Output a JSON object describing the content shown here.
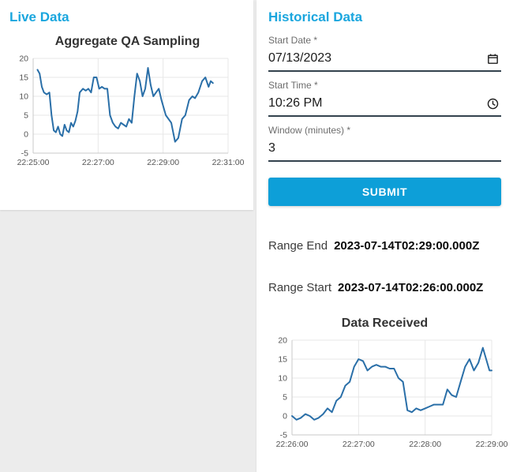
{
  "colors": {
    "accent": "#1aa6de",
    "button": "#0d9fd8",
    "underline": "#33424d",
    "chart_line": "#2a6fa8",
    "grid": "#e7e7e7"
  },
  "live_panel": {
    "title": "Live Data"
  },
  "historical_panel": {
    "title": "Historical Data",
    "fields": [
      {
        "label": "Start Date *",
        "value": "07/13/2023",
        "icon": "calendar-icon"
      },
      {
        "label": "Start Time *",
        "value": "10:26 PM",
        "icon": "clock-icon"
      },
      {
        "label": "Window (minutes) *",
        "value": "3",
        "icon": "none"
      }
    ],
    "submit_label": "SUBMIT",
    "range_end_label": "Range End",
    "range_end_value": "2023-07-14T02:29:00.000Z",
    "range_start_label": "Range Start",
    "range_start_value": "2023-07-14T02:26:00.000Z"
  },
  "chart_data": [
    {
      "type": "line",
      "title": "Aggregate QA Sampling",
      "xlabel": "",
      "ylabel": "",
      "legend": "none",
      "grid": true,
      "xlim": [
        0,
        360
      ],
      "ylim": [
        -5,
        20
      ],
      "yticks": [
        -5,
        0,
        5,
        10,
        15,
        20
      ],
      "xticks": [
        {
          "v": 0,
          "label": "22:25:00"
        },
        {
          "v": 120,
          "label": "22:27:00"
        },
        {
          "v": 240,
          "label": "22:29:00"
        },
        {
          "v": 360,
          "label": "22:31:00"
        }
      ],
      "series": [
        {
          "name": "Aggregate QA Sampling",
          "color": "#2a6fa8",
          "points": [
            [
              8,
              17
            ],
            [
              12,
              16
            ],
            [
              16,
              12.5
            ],
            [
              20,
              11
            ],
            [
              25,
              10.5
            ],
            [
              30,
              11
            ],
            [
              34,
              5
            ],
            [
              38,
              1
            ],
            [
              42,
              0.5
            ],
            [
              46,
              2
            ],
            [
              50,
              0
            ],
            [
              54,
              -0.5
            ],
            [
              58,
              2.5
            ],
            [
              62,
              1
            ],
            [
              66,
              0.5
            ],
            [
              70,
              3
            ],
            [
              74,
              2
            ],
            [
              78,
              3.5
            ],
            [
              82,
              6
            ],
            [
              86,
              11
            ],
            [
              92,
              12
            ],
            [
              97,
              11.5
            ],
            [
              102,
              12
            ],
            [
              107,
              11
            ],
            [
              112,
              15
            ],
            [
              117,
              15
            ],
            [
              122,
              12
            ],
            [
              127,
              12.5
            ],
            [
              132,
              12
            ],
            [
              137,
              12
            ],
            [
              142,
              5
            ],
            [
              147,
              3
            ],
            [
              152,
              2
            ],
            [
              157,
              1.5
            ],
            [
              162,
              3
            ],
            [
              167,
              2.5
            ],
            [
              172,
              2
            ],
            [
              177,
              4
            ],
            [
              182,
              3
            ],
            [
              187,
              10
            ],
            [
              192,
              16
            ],
            [
              197,
              14
            ],
            [
              202,
              10
            ],
            [
              207,
              12
            ],
            [
              212,
              17.5
            ],
            [
              217,
              13
            ],
            [
              222,
              10
            ],
            [
              227,
              11
            ],
            [
              232,
              12
            ],
            [
              237,
              9
            ],
            [
              245,
              5
            ],
            [
              255,
              3
            ],
            [
              262,
              -2
            ],
            [
              268,
              -1
            ],
            [
              275,
              4
            ],
            [
              281,
              5
            ],
            [
              288,
              9
            ],
            [
              294,
              10
            ],
            [
              299,
              9.5
            ],
            [
              305,
              11
            ],
            [
              312,
              14
            ],
            [
              318,
              15
            ],
            [
              324,
              12.5
            ],
            [
              328,
              14
            ],
            [
              332,
              13.5
            ]
          ]
        }
      ]
    },
    {
      "type": "line",
      "title": "Data Received",
      "xlabel": "",
      "ylabel": "",
      "legend": "none",
      "grid": true,
      "xlim": [
        0,
        180
      ],
      "ylim": [
        -5,
        20
      ],
      "yticks": [
        -5,
        0,
        5,
        10,
        15,
        20
      ],
      "xticks": [
        {
          "v": 0,
          "label": "22:26:00"
        },
        {
          "v": 60,
          "label": "22:27:00"
        },
        {
          "v": 120,
          "label": "22:28:00"
        },
        {
          "v": 180,
          "label": "22:29:00"
        }
      ],
      "series": [
        {
          "name": "Data Received",
          "color": "#2a6fa8",
          "points": [
            [
              0,
              0
            ],
            [
              4,
              -1
            ],
            [
              8,
              -0.5
            ],
            [
              12,
              0.5
            ],
            [
              16,
              0
            ],
            [
              20,
              -1
            ],
            [
              24,
              -0.5
            ],
            [
              28,
              0.5
            ],
            [
              32,
              2
            ],
            [
              36,
              1
            ],
            [
              40,
              4
            ],
            [
              44,
              5
            ],
            [
              48,
              8
            ],
            [
              52,
              9
            ],
            [
              56,
              13
            ],
            [
              60,
              15
            ],
            [
              64,
              14.5
            ],
            [
              68,
              12
            ],
            [
              72,
              13
            ],
            [
              76,
              13.5
            ],
            [
              80,
              13
            ],
            [
              84,
              13
            ],
            [
              88,
              12.5
            ],
            [
              92,
              12.5
            ],
            [
              96,
              10
            ],
            [
              100,
              9
            ],
            [
              104,
              1.5
            ],
            [
              108,
              1
            ],
            [
              112,
              2
            ],
            [
              116,
              1.5
            ],
            [
              120,
              2
            ],
            [
              124,
              2.5
            ],
            [
              128,
              3
            ],
            [
              132,
              3
            ],
            [
              136,
              3
            ],
            [
              140,
              7
            ],
            [
              144,
              5.5
            ],
            [
              148,
              5
            ],
            [
              152,
              9
            ],
            [
              156,
              13
            ],
            [
              160,
              15
            ],
            [
              164,
              12
            ],
            [
              168,
              14
            ],
            [
              172,
              18
            ],
            [
              175,
              15
            ],
            [
              178,
              12
            ],
            [
              180,
              12
            ]
          ]
        }
      ]
    }
  ]
}
